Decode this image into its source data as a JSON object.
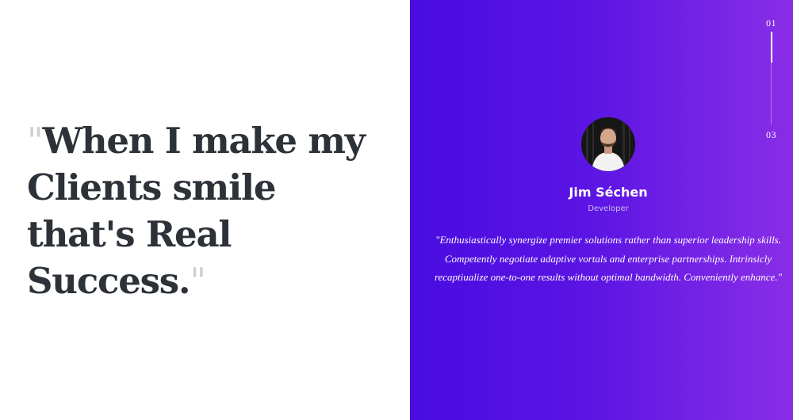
{
  "headline": {
    "open_quote": "\"",
    "line1": "When I make my",
    "line2": "Clients smile",
    "line3": "that's Real",
    "line4": "Success.",
    "close_quote": "\""
  },
  "testimonial": {
    "name": "Jim Séchen",
    "role": "Developer",
    "quote": "\"Enthusiastically synergize premier solutions rather than superior leadership skills. Competently negotiate adaptive vortals and enterprise partnerships. Intrinsicly recaptiualize one-to-one results without optimal bandwidth. Conveniently enhance.\""
  },
  "pager": {
    "current": "01",
    "total": "03",
    "progress": 0.33
  },
  "colors": {
    "gradient_start": "#4a0ce0",
    "gradient_end": "#8a2ee6",
    "headline": "#2d3238",
    "quote_mark": "#cfcfcf"
  }
}
